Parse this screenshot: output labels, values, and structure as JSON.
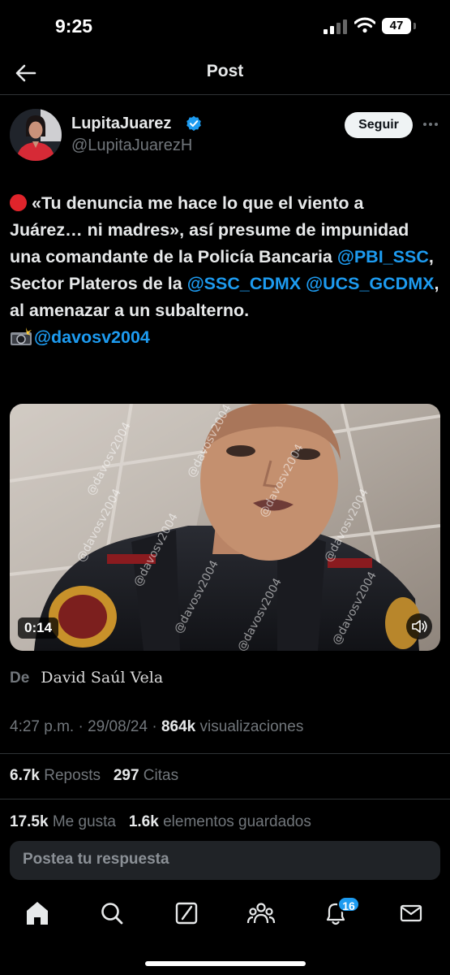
{
  "status_bar": {
    "time": "9:25",
    "battery": "47"
  },
  "header": {
    "title": "Post"
  },
  "author": {
    "display_name": "LupitaJuarez",
    "username": "@LupitaJuarezH",
    "follow_label": "Seguir"
  },
  "tweet": {
    "part1": "«Tu denuncia me hace lo que el viento a Juárez… ni madres», así presume de impunidad una comandante de la Policía Bancaria ",
    "mention1": "@PBI_SSC",
    "part2": ", Sector Plateros de la ",
    "mention2": "@SSC_CDMX",
    "mention3": "@UCS_GCDMX",
    "part3": ", al amenazar a un subalterno.",
    "mention4": "@davosv2004"
  },
  "media": {
    "duration": "0:14",
    "watermark": "@davosv2004"
  },
  "source": {
    "label": "De",
    "name": "David Saúl Vela"
  },
  "meta": {
    "time": "4:27 p.m.",
    "sep1": " · ",
    "date": "29/08/24",
    "sep2": " · ",
    "views_count": "864k",
    "views_label": " visualizaciones"
  },
  "stats": {
    "reposts_count": "6.7k",
    "reposts_label": "Reposts",
    "quotes_count": "297",
    "quotes_label": "Citas",
    "likes_count": "17.5k",
    "likes_label": "Me gusta",
    "bookmarks_count": "1.6k",
    "bookmarks_label": "elementos guardados"
  },
  "reply": {
    "placeholder": "Postea tu respuesta"
  },
  "tabbar": {
    "notifications_badge": "16"
  }
}
